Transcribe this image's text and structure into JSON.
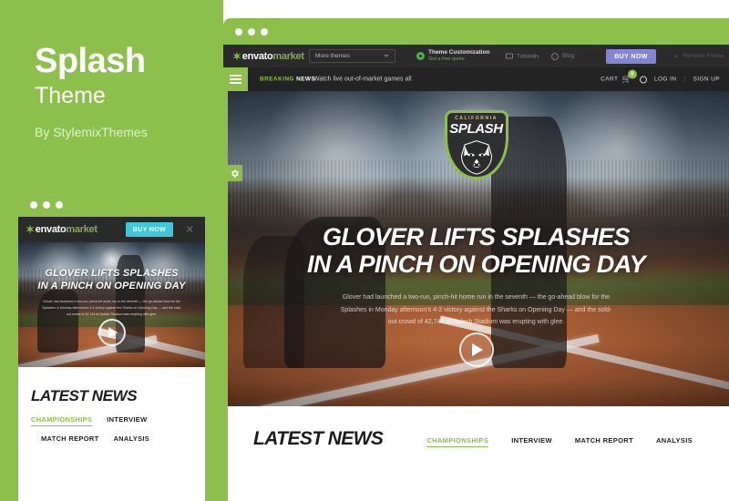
{
  "promo": {
    "theme_name": "Splash",
    "theme_sub": "Theme",
    "author": "By StylemixThemes",
    "background_color": "#8cbf4b"
  },
  "envato_bar": {
    "logo_leaf": "leaf-icon",
    "logo_primary": "envato",
    "logo_secondary": "market",
    "dropdown_value": "More themes",
    "dropdown_icon": "chevron-down-icon",
    "promo_title": "Theme Customization",
    "promo_subtitle": "Get a free quote",
    "promo_icon": "gear-icon",
    "tutorials_label": "Tutorials",
    "tutorials_icon": "video-icon",
    "blog_label": "Blog",
    "blog_icon": "blog-icon",
    "buy_now_label": "BUY NOW",
    "buy_now_color": "#8585d6",
    "remove_frame_label": "Remove Frame",
    "remove_frame_icon": "close-icon"
  },
  "site_nav": {
    "menu_icon": "hamburger-menu-icon",
    "breaking_green": "BREAKING",
    "breaking_white": "NEWS",
    "ticker_text": "Watch live out-of-market games all",
    "cart_label": "CART",
    "cart_icon": "shopping-cart-icon",
    "cart_count": "0",
    "login_label": "LOG IN",
    "login_icon": "user-icon",
    "separator": "|",
    "signup_label": "SIGN UP"
  },
  "logo": {
    "top_text": "CALIFORNIA",
    "main_text": "SPLASH",
    "mascot_icon": "wolf-head-icon",
    "accent_color": "#8cbf4b",
    "top_text_color": "#e7c45b"
  },
  "hero": {
    "settings_icon": "gear-icon",
    "title_line_1": "GLOVER LIFTS SPLASHES",
    "title_line_2": "IN A PINCH ON OPENING DAY",
    "paragraph": "Glover had launched a two-run, pinch-hit home run in the seventh — the go-ahead blow for the Splashes in Monday afternoon's 4-2 victory against the Sharks on Opening Day — and the sold-out crowd of 42,744 at Splash Stadium was erupting with glee.",
    "play_icon": "play-button-icon"
  },
  "latest_news": {
    "heading": "LATEST NEWS",
    "tabs": [
      {
        "label": "CHAMPIONSHIPS",
        "active": true
      },
      {
        "label": "INTERVIEW",
        "active": false
      },
      {
        "label": "MATCH REPORT",
        "active": false
      },
      {
        "label": "ANALYSIS",
        "active": false
      }
    ],
    "active_color": "#8cbf4b"
  },
  "small_window": {
    "logo_leaf": "leaf-icon",
    "logo_primary": "envato",
    "logo_secondary": "market",
    "buy_now_label": "BUY NOW",
    "buy_now_color": "#3ec7d9",
    "close_icon": "close-icon"
  },
  "window_controls": {
    "dots": [
      "dot-1",
      "dot-2",
      "dot-3"
    ]
  }
}
